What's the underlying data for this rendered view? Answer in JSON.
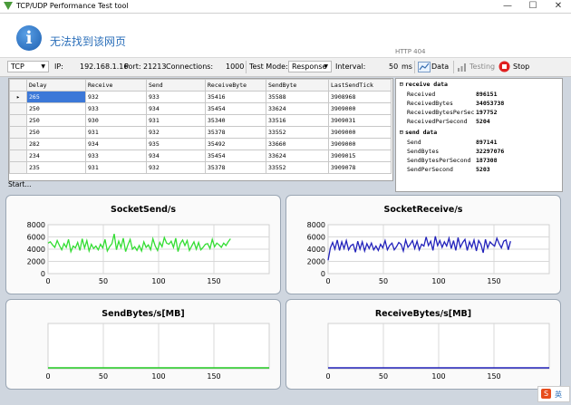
{
  "window": {
    "title": "TCP/UDP Performance Test tool",
    "min": "—",
    "max": "☐",
    "close": "✕"
  },
  "banner": {
    "message": "无法找到该网页",
    "http_code": "HTTP 404"
  },
  "toolbar": {
    "protocol": "TCP",
    "ip_label": "IP:",
    "ip": "192.168.1.16",
    "port_label": "Port:",
    "port": "21213",
    "connections_label": "Connections:",
    "connections": "1000",
    "mode_label": "Test Mode:",
    "mode": "Response",
    "interval_label": "Interval:",
    "interval": "50",
    "interval_unit": "ms",
    "data_label": "Data",
    "testing_label": "Testing",
    "stop_label": "Stop"
  },
  "grid": {
    "columns": [
      "Delay",
      "Receive",
      "Send",
      "ReceiveByte",
      "SendByte",
      "LastSendTick"
    ],
    "rows": [
      [
        "265",
        "932",
        "933",
        "35416",
        "35588",
        "3908968"
      ],
      [
        "250",
        "933",
        "934",
        "35454",
        "33624",
        "3909000"
      ],
      [
        "250",
        "930",
        "931",
        "35340",
        "33516",
        "3909031"
      ],
      [
        "250",
        "931",
        "932",
        "35378",
        "33552",
        "3909000"
      ],
      [
        "282",
        "934",
        "935",
        "35492",
        "33660",
        "3909000"
      ],
      [
        "234",
        "933",
        "934",
        "35454",
        "33624",
        "3909015"
      ],
      [
        "235",
        "931",
        "932",
        "35378",
        "33552",
        "3909078"
      ]
    ]
  },
  "status": "Start...",
  "stats": {
    "receive_header": "receive data",
    "receive": [
      {
        "k": "Received",
        "v": "896151"
      },
      {
        "k": "ReceivedBytes",
        "v": "34053738"
      },
      {
        "k": "ReceivedBytesPerSec",
        "v": "197752"
      },
      {
        "k": "ReceivedPerSecond",
        "v": "5204"
      }
    ],
    "send_header": "send data",
    "send": [
      {
        "k": "Send",
        "v": "897141"
      },
      {
        "k": "SendBytes",
        "v": "32297076"
      },
      {
        "k": "SendBytesPerSecond",
        "v": "187308"
      },
      {
        "k": "SendPerSecond",
        "v": "5203"
      }
    ]
  },
  "chart_data": [
    {
      "type": "line",
      "title": "SocketSend/s",
      "color": "#33dd33",
      "xlim": [
        0,
        200
      ],
      "ylim": [
        0,
        8000
      ],
      "xticks": [
        0,
        50,
        100,
        150
      ],
      "yticks": [
        0,
        2000,
        4000,
        6000,
        8000
      ],
      "series": [
        {
          "values": [
            5000,
            5200,
            4700,
            4300,
            5400,
            4600,
            3900,
            4900,
            4300,
            5600,
            3600,
            4500,
            4200,
            5100,
            3800,
            5700,
            4200,
            5400,
            3700,
            4800,
            4100,
            4500,
            3900,
            4800,
            4200,
            5600,
            3700,
            4400,
            4900,
            6500,
            3900,
            5300,
            4300,
            5800,
            3600,
            4700,
            5600,
            4000,
            4400,
            3800,
            4600,
            3700,
            5200,
            4300,
            4700,
            3900,
            5700,
            4500,
            3800,
            5100,
            4400,
            5900,
            5000,
            4800,
            5300,
            4300,
            5800,
            3600,
            4900,
            5500,
            4600,
            5400,
            3800,
            4500,
            5200,
            4000,
            5100,
            3900,
            4300,
            4800,
            4900,
            4100,
            5600,
            4400,
            5000,
            4700,
            4300,
            5000,
            4600,
            5200,
            5700
          ]
        }
      ]
    },
    {
      "type": "line",
      "title": "SocketReceive/s",
      "color": "#2222bb",
      "xlim": [
        0,
        200
      ],
      "ylim": [
        0,
        8000
      ],
      "xticks": [
        0,
        50,
        100,
        150
      ],
      "yticks": [
        0,
        2000,
        4000,
        6000,
        8000
      ],
      "series": [
        {
          "values": [
            2200,
            4200,
            5100,
            4000,
            5500,
            3800,
            5200,
            4100,
            5400,
            3900,
            4600,
            4800,
            3500,
            5300,
            4000,
            5200,
            3700,
            4900,
            4100,
            5000,
            3900,
            4500,
            3800,
            4800,
            4200,
            5400,
            3900,
            4600,
            5000,
            3900,
            4400,
            5100,
            4800,
            3700,
            5500,
            4300,
            4800,
            5400,
            4100,
            5300,
            3900,
            4800,
            4500,
            6000,
            4600,
            5300,
            3800,
            6100,
            4600,
            5400,
            4300,
            5200,
            4500,
            5800,
            4100,
            5400,
            3800,
            5900,
            4300,
            5100,
            5600,
            3800,
            5200,
            4300,
            5500,
            3700,
            5400,
            4800,
            3400,
            5600,
            4200,
            5200,
            4800,
            4500,
            5800,
            4900,
            4200,
            5300,
            5500,
            3900,
            5300
          ]
        }
      ]
    },
    {
      "type": "line",
      "title": "SendBytes/s[MB]",
      "color": "#22cc22",
      "xlim": [
        0,
        200
      ],
      "ylim": [
        0,
        1
      ],
      "xticks": [
        0,
        50,
        100,
        150
      ],
      "yticks": [],
      "series": [
        {
          "values": [
            0.02,
            0.02
          ]
        }
      ]
    },
    {
      "type": "line",
      "title": "ReceiveBytes/s[MB]",
      "color": "#2222bb",
      "xlim": [
        0,
        200
      ],
      "ylim": [
        0,
        1
      ],
      "xticks": [
        0,
        50,
        100,
        150
      ],
      "yticks": [],
      "series": [
        {
          "values": [
            0.02,
            0.02
          ]
        }
      ]
    }
  ],
  "footer": {
    "badge": "英"
  }
}
